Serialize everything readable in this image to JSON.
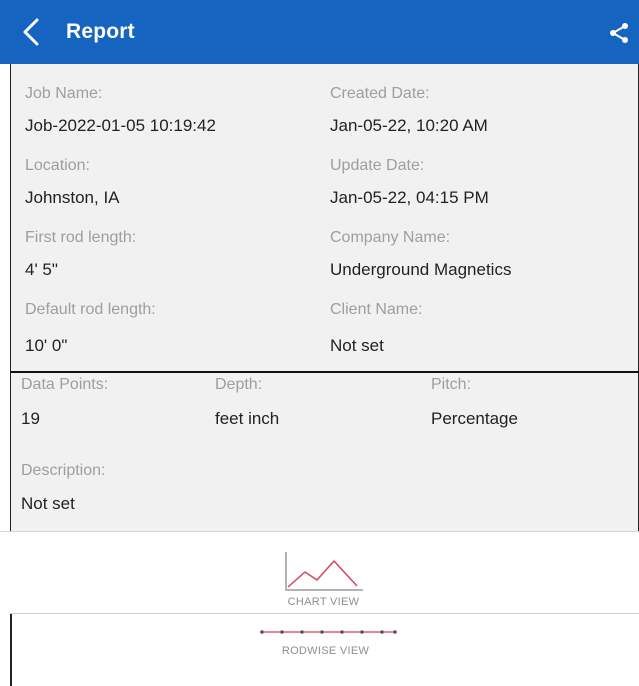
{
  "header": {
    "title": "Report"
  },
  "info": {
    "job_name_label": "Job Name:",
    "job_name": "Job-2022-01-05 10:19:42",
    "created_date_label": "Created Date:",
    "created_date": "Jan-05-22, 10:20 AM",
    "location_label": "Location:",
    "location": "Johnston, IA",
    "update_date_label": "Update Date:",
    "update_date": "Jan-05-22, 04:15 PM",
    "first_rod_label": "First rod length:",
    "first_rod": "4'  5\"",
    "company_label": "Company Name:",
    "company": "Underground Magnetics",
    "default_rod_label": "Default rod length:",
    "default_rod": "10'  0\"",
    "client_label": "Client Name:",
    "client": "Not set",
    "data_points_label": "Data Points:",
    "data_points": "19",
    "depth_label": "Depth:",
    "depth": "feet inch",
    "pitch_label": "Pitch:",
    "pitch": "Percentage",
    "description_label": "Description:",
    "description": "Not set"
  },
  "views": {
    "chart_label": "CHART VIEW",
    "rodwise_label": "RODWISE VIEW"
  },
  "colors": {
    "appbar": "#1565c0",
    "panel_bg": "#f1f1f1",
    "chart_icon_line": "#d6455c",
    "label_gray": "#9e9e9e"
  },
  "icons": [
    "back-chevron-icon",
    "share-icon",
    "line-chart-icon",
    "rodwise-dots-icon"
  ]
}
